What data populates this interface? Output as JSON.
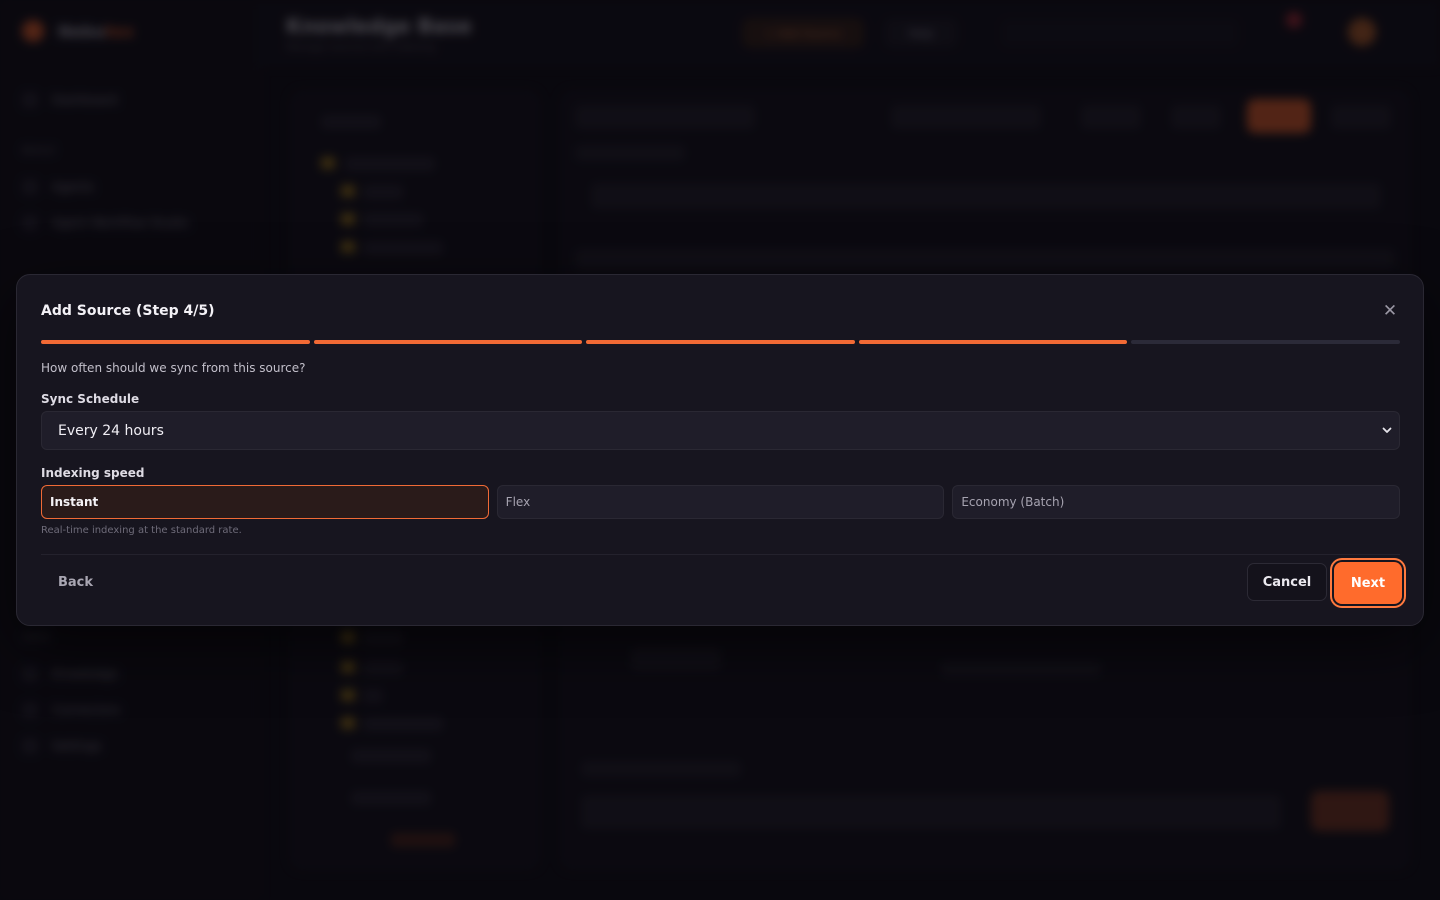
{
  "background": {
    "brand": {
      "name": "Nebu",
      "accent_text": "tex"
    },
    "page_title": "Knowledge Base",
    "page_subtitle": "Manage sources and indexing",
    "topbar": {
      "primary_action": "+ Add Source",
      "secondary_action": "Help"
    },
    "sidebar": {
      "top_item": "Dashboard",
      "groups": [
        {
          "title": "Build",
          "items": [
            "Agents",
            "Agent Workflow Studio"
          ]
        },
        {
          "title": "Data",
          "items": [
            "Knowledge",
            "Connectors",
            "Settings"
          ]
        }
      ]
    }
  },
  "modal": {
    "title": "Add Source (Step 4/5)",
    "close_icon": "close-icon",
    "steps_total": 5,
    "steps_completed": 4,
    "question": "How often should we sync from this source?",
    "sync_schedule": {
      "label": "Sync Schedule",
      "selected": "Every 24 hours"
    },
    "indexing_speed": {
      "label": "Indexing speed",
      "options": [
        "Instant",
        "Flex",
        "Economy (Batch)"
      ],
      "selected_index": 0,
      "hint": "Real-time indexing at the standard rate."
    },
    "footer": {
      "back_label": "Back",
      "cancel_label": "Cancel",
      "next_label": "Next"
    }
  },
  "colors": {
    "accent": "#ff6b2c",
    "modal_bg": "#17151f",
    "page_bg": "#0c0b11"
  }
}
